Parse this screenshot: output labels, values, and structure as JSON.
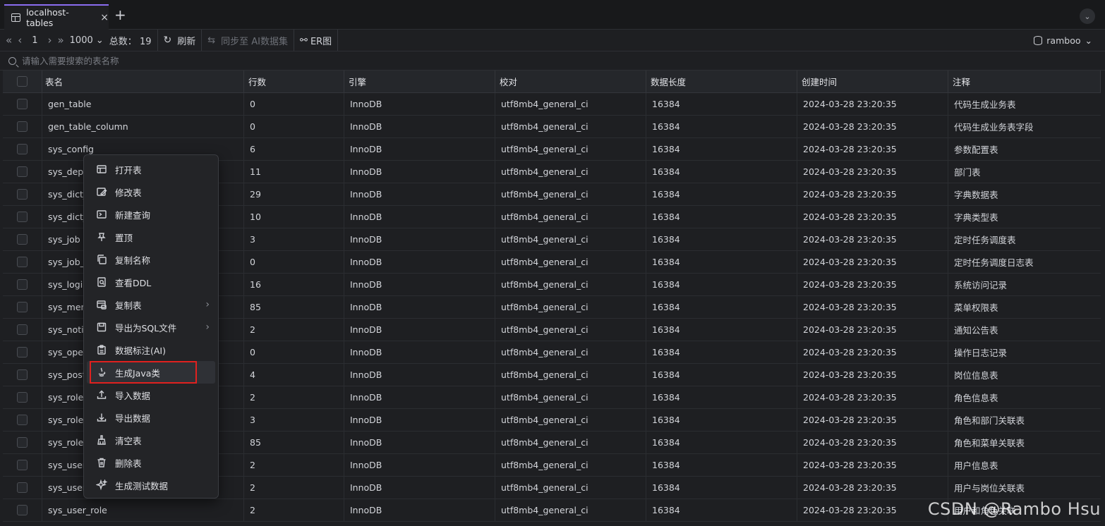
{
  "tab": {
    "title": "localhost-tables",
    "close": "×",
    "add": "+",
    "collapse": "⌄"
  },
  "toolbar": {
    "first": "«",
    "prev": "‹",
    "page": "1",
    "next": "›",
    "last": "»",
    "page_size": "1000",
    "total_label": "总数：",
    "total": "19",
    "refresh": "刷新",
    "sync_ai": "同步至 AI数据集",
    "er": "ER图",
    "user": "ramboo"
  },
  "search": {
    "placeholder": "请输入需要搜索的表名称"
  },
  "table": {
    "columns": [
      "表名",
      "行数",
      "引擎",
      "校对",
      "数据长度",
      "创建时间",
      "注释"
    ],
    "rows": [
      [
        "gen_table",
        "0",
        "InnoDB",
        "utf8mb4_general_ci",
        "16384",
        "2024-03-28 23:20:35",
        "代码生成业务表"
      ],
      [
        "gen_table_column",
        "0",
        "InnoDB",
        "utf8mb4_general_ci",
        "16384",
        "2024-03-28 23:20:35",
        "代码生成业务表字段"
      ],
      [
        "sys_config",
        "6",
        "InnoDB",
        "utf8mb4_general_ci",
        "16384",
        "2024-03-28 23:20:35",
        "参数配置表"
      ],
      [
        "sys_dept",
        "11",
        "InnoDB",
        "utf8mb4_general_ci",
        "16384",
        "2024-03-28 23:20:35",
        "部门表"
      ],
      [
        "sys_dict_",
        "29",
        "InnoDB",
        "utf8mb4_general_ci",
        "16384",
        "2024-03-28 23:20:35",
        "字典数据表"
      ],
      [
        "sys_dict_",
        "10",
        "InnoDB",
        "utf8mb4_general_ci",
        "16384",
        "2024-03-28 23:20:35",
        "字典类型表"
      ],
      [
        "sys_job",
        "3",
        "InnoDB",
        "utf8mb4_general_ci",
        "16384",
        "2024-03-28 23:20:35",
        "定时任务调度表"
      ],
      [
        "sys_job_",
        "0",
        "InnoDB",
        "utf8mb4_general_ci",
        "16384",
        "2024-03-28 23:20:35",
        "定时任务调度日志表"
      ],
      [
        "sys_logir",
        "16",
        "InnoDB",
        "utf8mb4_general_ci",
        "16384",
        "2024-03-28 23:20:35",
        "系统访问记录"
      ],
      [
        "sys_men",
        "85",
        "InnoDB",
        "utf8mb4_general_ci",
        "16384",
        "2024-03-28 23:20:35",
        "菜单权限表"
      ],
      [
        "sys_notic",
        "2",
        "InnoDB",
        "utf8mb4_general_ci",
        "16384",
        "2024-03-28 23:20:35",
        "通知公告表"
      ],
      [
        "sys_oper",
        "0",
        "InnoDB",
        "utf8mb4_general_ci",
        "16384",
        "2024-03-28 23:20:35",
        "操作日志记录"
      ],
      [
        "sys_post",
        "4",
        "InnoDB",
        "utf8mb4_general_ci",
        "16384",
        "2024-03-28 23:20:35",
        "岗位信息表"
      ],
      [
        "sys_role",
        "2",
        "InnoDB",
        "utf8mb4_general_ci",
        "16384",
        "2024-03-28 23:20:35",
        "角色信息表"
      ],
      [
        "sys_role_",
        "3",
        "InnoDB",
        "utf8mb4_general_ci",
        "16384",
        "2024-03-28 23:20:35",
        "角色和部门关联表"
      ],
      [
        "sys_role_",
        "85",
        "InnoDB",
        "utf8mb4_general_ci",
        "16384",
        "2024-03-28 23:20:35",
        "角色和菜单关联表"
      ],
      [
        "sys_user",
        "2",
        "InnoDB",
        "utf8mb4_general_ci",
        "16384",
        "2024-03-28 23:20:35",
        "用户信息表"
      ],
      [
        "sys_user",
        "2",
        "InnoDB",
        "utf8mb4_general_ci",
        "16384",
        "2024-03-28 23:20:35",
        "用户与岗位关联表"
      ],
      [
        "sys_user_role",
        "2",
        "InnoDB",
        "utf8mb4_general_ci",
        "16384",
        "2024-03-28 23:20:35",
        "用户和角色关联"
      ]
    ]
  },
  "context_menu": {
    "items": [
      {
        "label": "打开表",
        "icon": "table-icon"
      },
      {
        "label": "修改表",
        "icon": "edit-icon"
      },
      {
        "label": "新建查询",
        "icon": "terminal-icon"
      },
      {
        "label": "置顶",
        "icon": "pin-icon"
      },
      {
        "label": "复制名称",
        "icon": "copy-icon"
      },
      {
        "label": "查看DDL",
        "icon": "view-ddl-icon"
      },
      {
        "label": "复制表",
        "icon": "copy-table-icon",
        "submenu": true
      },
      {
        "label": "导出为SQL文件",
        "icon": "save-icon",
        "submenu": true
      },
      {
        "label": "数据标注(AI)",
        "icon": "clipboard-icon"
      },
      {
        "label": "生成Java类",
        "icon": "java-icon",
        "active": true
      },
      {
        "label": "导入数据",
        "icon": "upload-icon"
      },
      {
        "label": "导出数据",
        "icon": "download-icon"
      },
      {
        "label": "清空表",
        "icon": "broom-icon"
      },
      {
        "label": "删除表",
        "icon": "trash-icon"
      },
      {
        "label": "生成测试数据",
        "icon": "sparkle-icon"
      }
    ],
    "submenu_arrow": "›"
  },
  "watermark": "CSDN @Rambo Hsu",
  "colors": {
    "accent": "#8a6cf0",
    "highlight": "#e0211f",
    "background": "#1e1f22"
  }
}
